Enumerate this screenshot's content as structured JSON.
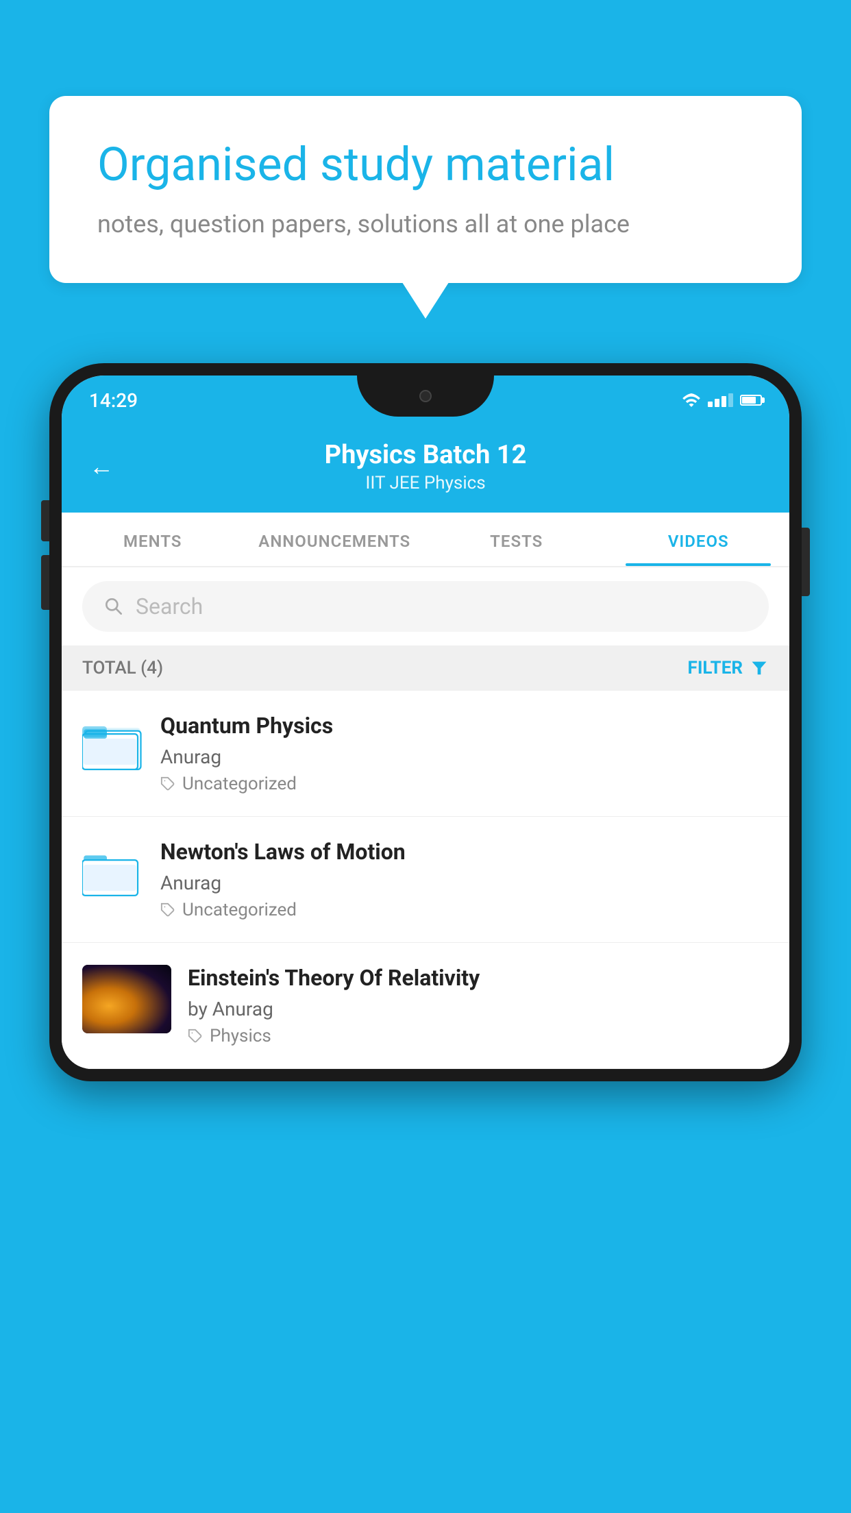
{
  "background_color": "#1ab4e8",
  "speech_bubble": {
    "title": "Organised study material",
    "subtitle": "notes, question papers, solutions all at one place"
  },
  "phone": {
    "status_bar": {
      "time": "14:29"
    },
    "header": {
      "title": "Physics Batch 12",
      "subtitle": "IIT JEE   Physics",
      "back_label": "←"
    },
    "tabs": [
      {
        "label": "MENTS",
        "active": false
      },
      {
        "label": "ANNOUNCEMENTS",
        "active": false
      },
      {
        "label": "TESTS",
        "active": false
      },
      {
        "label": "VIDEOS",
        "active": true
      }
    ],
    "search": {
      "placeholder": "Search"
    },
    "filter_bar": {
      "total_label": "TOTAL (4)",
      "filter_label": "FILTER"
    },
    "video_items": [
      {
        "id": "quantum",
        "title": "Quantum Physics",
        "author": "Anurag",
        "tag": "Uncategorized",
        "has_thumbnail": false
      },
      {
        "id": "newton",
        "title": "Newton's Laws of Motion",
        "author": "Anurag",
        "tag": "Uncategorized",
        "has_thumbnail": false
      },
      {
        "id": "einstein",
        "title": "Einstein's Theory Of Relativity",
        "author": "by Anurag",
        "tag": "Physics",
        "has_thumbnail": true
      }
    ]
  }
}
